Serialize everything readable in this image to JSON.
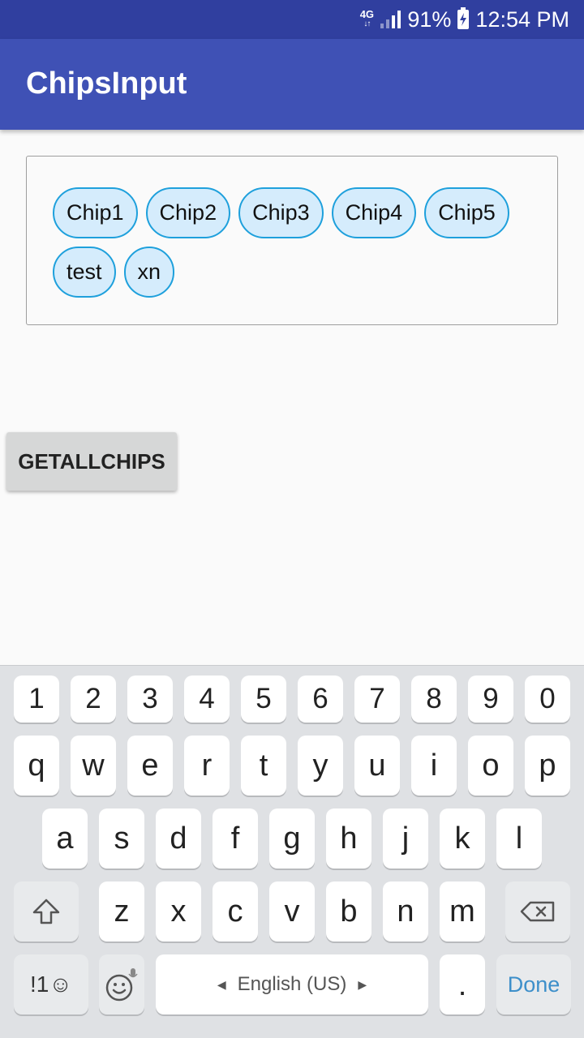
{
  "status_bar": {
    "network": "4G",
    "battery_percent": "91%",
    "time": "12:54 PM",
    "icons": [
      "network-4g-icon",
      "signal-icon",
      "battery-charging-icon"
    ]
  },
  "app_bar": {
    "title": "ChipsInput"
  },
  "chips": [
    "Chip1",
    "Chip2",
    "Chip3",
    "Chip4",
    "Chip5",
    "test",
    "xn"
  ],
  "button": {
    "label": "GETALLCHIPS"
  },
  "keyboard": {
    "number_row": [
      "1",
      "2",
      "3",
      "4",
      "5",
      "6",
      "7",
      "8",
      "9",
      "0"
    ],
    "row1": [
      "q",
      "w",
      "e",
      "r",
      "t",
      "y",
      "u",
      "i",
      "o",
      "p"
    ],
    "row2": [
      "a",
      "s",
      "d",
      "f",
      "g",
      "h",
      "j",
      "k",
      "l"
    ],
    "row3": [
      "z",
      "x",
      "c",
      "v",
      "b",
      "n",
      "m"
    ],
    "symbols_key": "!1☺",
    "space_label": "English (US)",
    "period_key": ".",
    "done_key": "Done",
    "icons": [
      "shift-icon",
      "backspace-icon",
      "emoji-icon",
      "mic-icon"
    ]
  },
  "colors": {
    "status_bar": "#303f9f",
    "app_bar": "#3f51b5",
    "chip_border": "#1ea0dc",
    "chip_fill": "#d5ecfc",
    "done": "#3d8fca"
  }
}
